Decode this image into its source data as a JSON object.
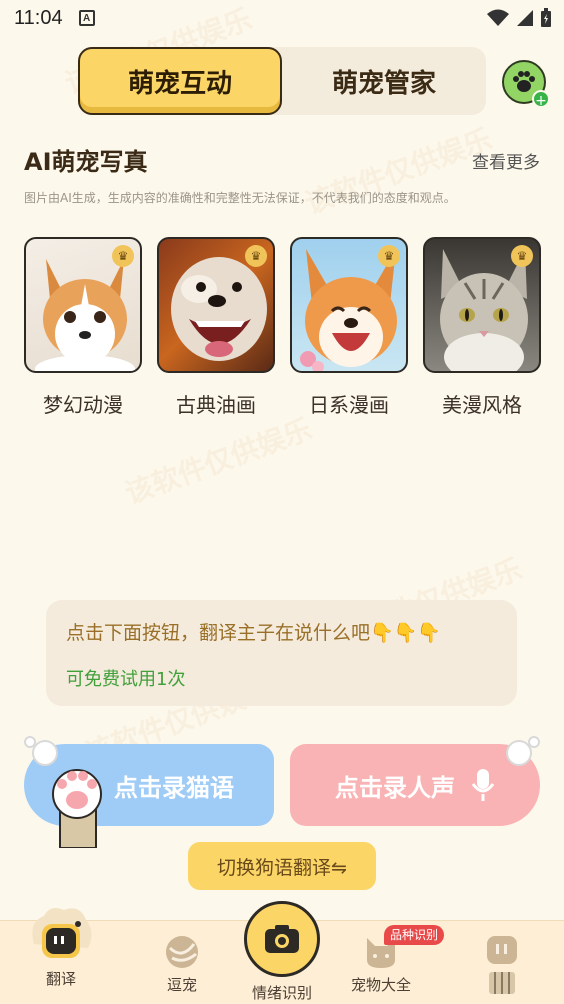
{
  "status": {
    "time": "11:04"
  },
  "top_tabs": {
    "active": "萌宠互动",
    "inactive": "萌宠管家"
  },
  "section": {
    "title": "AI萌宠写真",
    "see_more": "查看更多",
    "disclaimer": "图片由AI生成，生成内容的准确性和完整性无法保证，不代表我们的态度和观点。"
  },
  "styles": [
    {
      "label": "梦幻动漫"
    },
    {
      "label": "古典油画"
    },
    {
      "label": "日系漫画"
    },
    {
      "label": "美漫风格"
    }
  ],
  "hint": {
    "text": "点击下面按钮，翻译主子在说什么吧👇👇👇",
    "free": "可免费试用1次"
  },
  "record": {
    "cat": "点击录猫语",
    "human": "点击录人声"
  },
  "switch": "切换狗语翻译⇋",
  "watermark": "该软件仅供娱乐",
  "tabbar": {
    "items": [
      {
        "label": "翻译"
      },
      {
        "label": "逗宠"
      },
      {
        "label": "情绪识别"
      },
      {
        "label": "宠物大全"
      },
      {
        "label": ""
      }
    ],
    "badge": "品种识别"
  },
  "colors": {
    "accent": "#fbd667",
    "cat_button": "#9fccf6",
    "human_button": "#f9b3b4",
    "green": "#41a03b"
  }
}
